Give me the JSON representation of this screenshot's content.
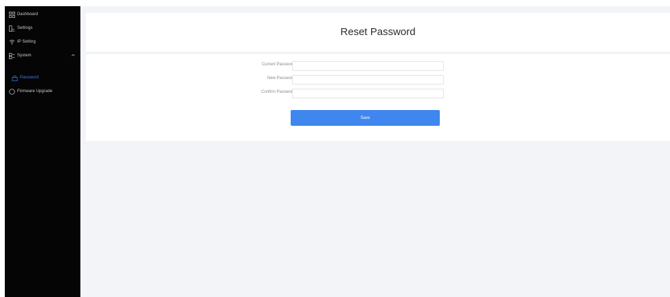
{
  "sidebar": {
    "items": [
      {
        "label": "Dashboard",
        "icon": "grid-icon"
      },
      {
        "label": "Settings",
        "icon": "settings-icon"
      },
      {
        "label": "IP Setting",
        "icon": "network-icon"
      },
      {
        "label": "System",
        "icon": "system-icon"
      },
      {
        "label": "Password",
        "icon": "lock-icon"
      },
      {
        "label": "Firmware Upgrade",
        "icon": "upgrade-icon"
      }
    ]
  },
  "header": {
    "title": "Reset Password"
  },
  "form": {
    "current_password_label": "Current Password",
    "new_password_label": "New Password",
    "confirm_password_label": "Confirm Password",
    "current_password_value": "",
    "new_password_value": "",
    "confirm_password_value": "",
    "save_label": "Save"
  },
  "colors": {
    "sidebar_bg": "#050505",
    "active": "#3b82f6",
    "primary_button": "#3f86ee",
    "main_bg": "#f3f4f7"
  }
}
